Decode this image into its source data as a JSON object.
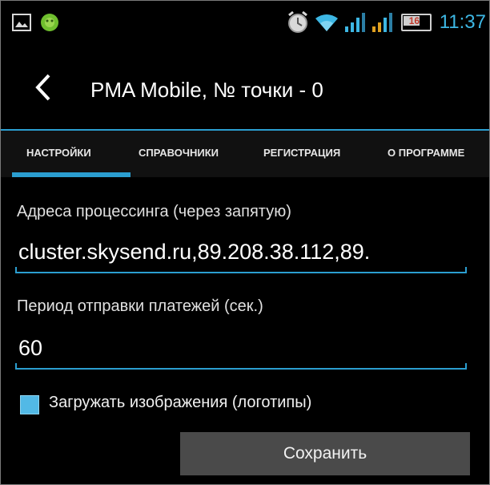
{
  "status_bar": {
    "time": "11:37",
    "battery_level": "16",
    "icons": [
      "image-icon",
      "android-icon",
      "alarm-clock-icon",
      "wifi-icon",
      "signal-icon",
      "signal-icon",
      "battery-icon"
    ]
  },
  "header": {
    "title": "PMA Mobile, № точки - 0"
  },
  "tabs": [
    {
      "label": "НАСТРОЙКИ",
      "active": true
    },
    {
      "label": "СПРАВОЧНИКИ",
      "active": false
    },
    {
      "label": "РЕГИСТРАЦИЯ",
      "active": false
    },
    {
      "label": "О ПРОГРАММЕ",
      "active": false
    }
  ],
  "settings": {
    "processing_label": "Адреса процессинга (через запятую)",
    "processing_value": "cluster.skysend.ru,89.208.38.112,89.",
    "period_label": "Период отправки платежей (сек.)",
    "period_value": "60",
    "load_images_label": "Загружать изображения (логотипы)",
    "load_images_checked": true,
    "save_label": "Сохранить"
  },
  "colors": {
    "accent": "#2b9ed0",
    "clock": "#3db7e4",
    "checkbox": "#52b9e6",
    "background": "#000000"
  }
}
